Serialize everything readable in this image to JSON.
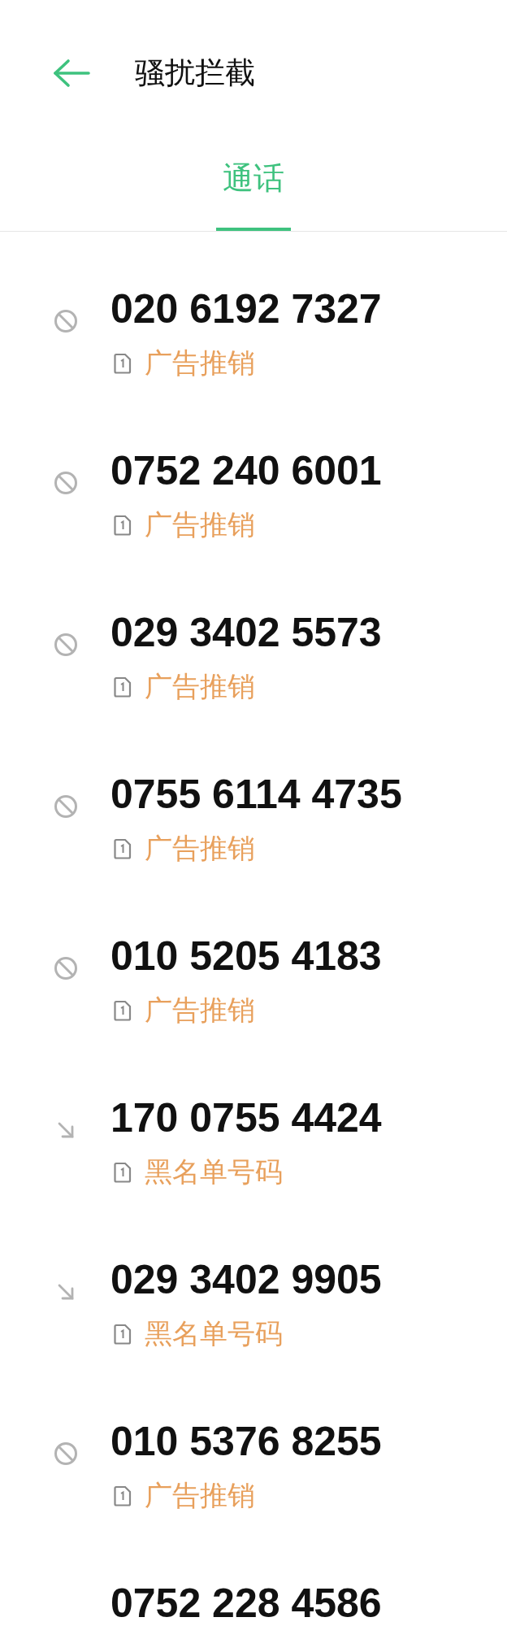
{
  "header": {
    "title": "骚扰拦截"
  },
  "tabs": [
    {
      "label": "通话",
      "selected": true
    }
  ],
  "calls": [
    {
      "number": "020 6192 7327",
      "kind": "blocked",
      "tag": "广告推销"
    },
    {
      "number": "0752 240 6001",
      "kind": "blocked",
      "tag": "广告推销"
    },
    {
      "number": "029 3402 5573",
      "kind": "blocked",
      "tag": "广告推销"
    },
    {
      "number": "0755 6114 4735",
      "kind": "blocked",
      "tag": "广告推销"
    },
    {
      "number": "010 5205 4183",
      "kind": "blocked",
      "tag": "广告推销"
    },
    {
      "number": "170 0755 4424",
      "kind": "incoming",
      "tag": "黑名单号码"
    },
    {
      "number": "029 3402 9905",
      "kind": "incoming",
      "tag": "黑名单号码"
    },
    {
      "number": "010 5376 8255",
      "kind": "blocked",
      "tag": "广告推销"
    },
    {
      "number": "0752 228 4586"
    }
  ]
}
